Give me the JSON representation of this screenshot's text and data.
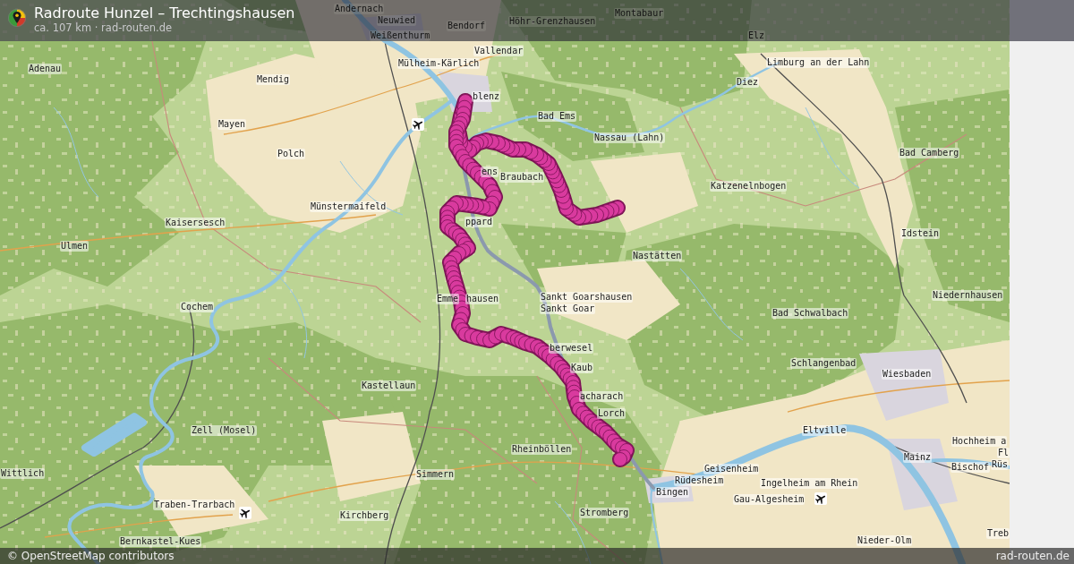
{
  "header": {
    "title": "Radroute Hunzel – Trechtingshausen",
    "subtitle": "ca. 107 km · rad-routen.de"
  },
  "map": {
    "place_labels": [
      "Andernach",
      "Montabaur",
      "Neuwied",
      "Bendorf",
      "Höhr-Grenzhausen",
      "Weißenthurm",
      "Elz",
      "Vallendar",
      "Mülheim-Kärlich",
      "Limburg an der Lahn",
      "Adenau",
      "Mendig",
      "Diez",
      "blenz",
      "Bad Ems",
      "Mayen",
      "Nassau (Lahn)",
      "Polch",
      "Bad Camberg",
      "ens",
      "Braubach",
      "Katzenelnbogen",
      "Münstermaifeld",
      "Kaisersesch",
      "ppard",
      "Idstein",
      "Ulmen",
      "Nastätten",
      "Emme",
      "hausen",
      "Sankt Goarshausen",
      "Niedernhausen",
      "Cochem",
      "Sankt Goar",
      "Bad Schwalbach",
      "berwesel",
      "Kaub",
      "Schlangenbad",
      "Wiesbaden",
      "Kastellaun",
      "acharach",
      "Lorch",
      "Zell (Mosel)",
      "Eltville",
      "Hochheim a",
      "Rheinböllen",
      "Fl",
      "Mainz",
      "Geisenheim",
      "Bischof",
      "Rüs",
      "Wittlich",
      "Simmern",
      "Rüdesheim",
      "Ingelheim am Rhein",
      "Bingen",
      "Gau-Algesheim",
      "Traben-Trarbach",
      "Kirchberg",
      "Stromberg",
      "Treb",
      "Bernkastel-Kues",
      "Nieder-Olm"
    ]
  },
  "footer": {
    "attribution": "© OpenStreetMap contributors",
    "site": "rad-routen.de"
  }
}
